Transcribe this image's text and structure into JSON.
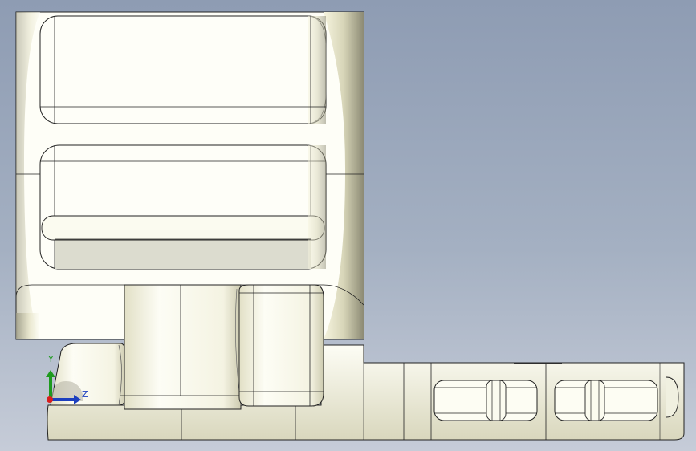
{
  "viewport": {
    "background_top": "#8e9cb3",
    "background_bottom": "#c6ccd8",
    "model_color": "#fefef6",
    "edge_color": "#111111"
  },
  "triad": {
    "y_label": "Y",
    "z_label": "Z",
    "y_color": "#1e9a1e",
    "z_color": "#1c3fbf",
    "x_color": "#d81e1e"
  }
}
